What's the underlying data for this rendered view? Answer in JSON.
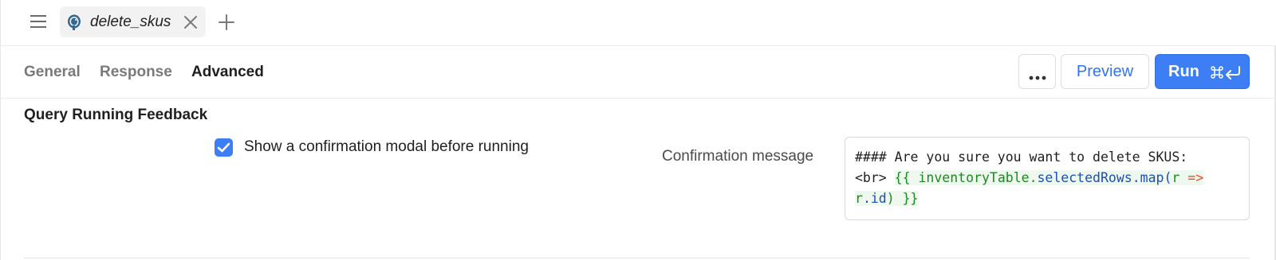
{
  "tab": {
    "name": "delete_skus",
    "icon": "postgres-elephant-icon"
  },
  "subtabs": [
    {
      "label": "General",
      "active": false
    },
    {
      "label": "Response",
      "active": false
    },
    {
      "label": "Advanced",
      "active": true
    }
  ],
  "toolbar": {
    "more_icon": "more-horizontal-icon",
    "preview_label": "Preview",
    "run_label": "Run",
    "run_shortcut_icons": [
      "command-key-icon",
      "enter-key-icon"
    ]
  },
  "section": {
    "title": "Query Running Feedback",
    "checkbox_label": "Show a confirmation modal before running",
    "checkbox_checked": true,
    "confirmation_label": "Confirmation message",
    "code": {
      "line1": "#### Are you sure you want to delete SKUS:",
      "line2_prefix": "<br> ",
      "line2_open": "{{ ",
      "line2_obj": "inventoryTable",
      "line2_dot": ".",
      "line2_prop": "selectedRows",
      "line2_map": ".map(",
      "line2_param": "r ",
      "line2_arrow": "=>",
      "line3_var": "r",
      "line3_prop": ".id",
      "line3_close": ") }}"
    }
  },
  "colors": {
    "accent": "#3d7ef5",
    "link": "#2f74f0",
    "code_green": "#1a8a1f",
    "code_blue": "#1b4fb3",
    "code_red": "#e0522b"
  }
}
